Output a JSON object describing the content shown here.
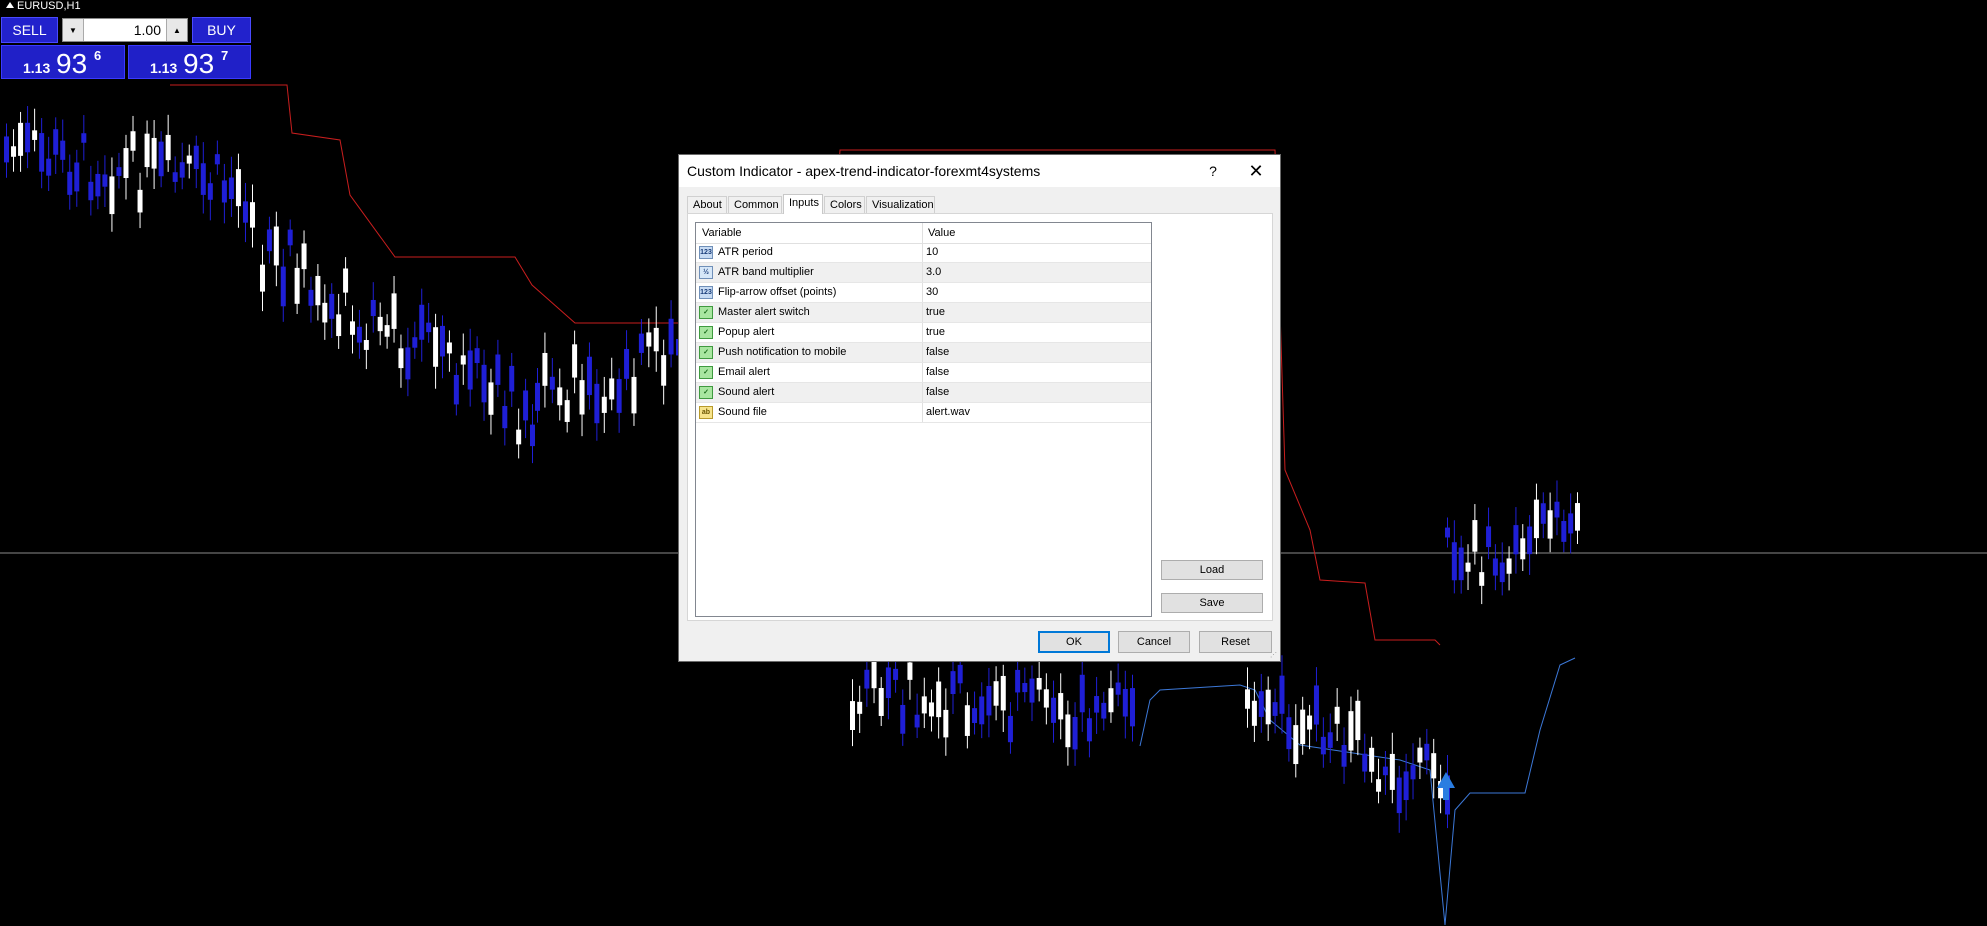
{
  "chart": {
    "symbol": "EURUSD,H1"
  },
  "trade_panel": {
    "sell_label": "SELL",
    "buy_label": "BUY",
    "lot": "1.00",
    "sell_price": {
      "prefix": "1.13",
      "big": "93",
      "sup": "6"
    },
    "buy_price": {
      "prefix": "1.13",
      "big": "93",
      "sup": "7"
    }
  },
  "dialog": {
    "title": "Custom Indicator - apex-trend-indicator-forexmt4systems",
    "help_label": "?",
    "close_label": "✕",
    "tabs": [
      "About",
      "Common",
      "Inputs",
      "Colors",
      "Visualization"
    ],
    "active_tab": "Inputs",
    "columns": {
      "variable": "Variable",
      "value": "Value"
    },
    "rows": [
      {
        "icon": "int-icon",
        "icon_text": "123",
        "name": "ATR period",
        "value": "10"
      },
      {
        "icon": "double-icon",
        "icon_text": "½",
        "name": "ATR band multiplier",
        "value": "3.0"
      },
      {
        "icon": "int-icon",
        "icon_text": "123",
        "name": "Flip-arrow offset (points)",
        "value": "30"
      },
      {
        "icon": "bool-icon",
        "icon_text": "✓",
        "name": "Master alert switch",
        "value": "true"
      },
      {
        "icon": "bool-icon",
        "icon_text": "✓",
        "name": "Popup alert",
        "value": "true"
      },
      {
        "icon": "bool-icon",
        "icon_text": "✓",
        "name": "Push notification to mobile",
        "value": "false"
      },
      {
        "icon": "bool-icon",
        "icon_text": "✓",
        "name": "Email alert",
        "value": "false"
      },
      {
        "icon": "bool-icon",
        "icon_text": "✓",
        "name": "Sound alert",
        "value": "false"
      },
      {
        "icon": "string-icon",
        "icon_text": "ab",
        "name": "Sound file",
        "value": "alert.wav"
      }
    ],
    "buttons": {
      "load": "Load",
      "save": "Save",
      "ok": "OK",
      "cancel": "Cancel",
      "reset": "Reset"
    }
  },
  "colors": {
    "background": "#000000",
    "bull_candle": "#ffffff",
    "bear_candle": "#1f1fd6",
    "resistance_line": "#c81e1e",
    "support_line": "#3c78d8",
    "panel_blue": "#2222cc",
    "ok_border": "#0078d7"
  }
}
